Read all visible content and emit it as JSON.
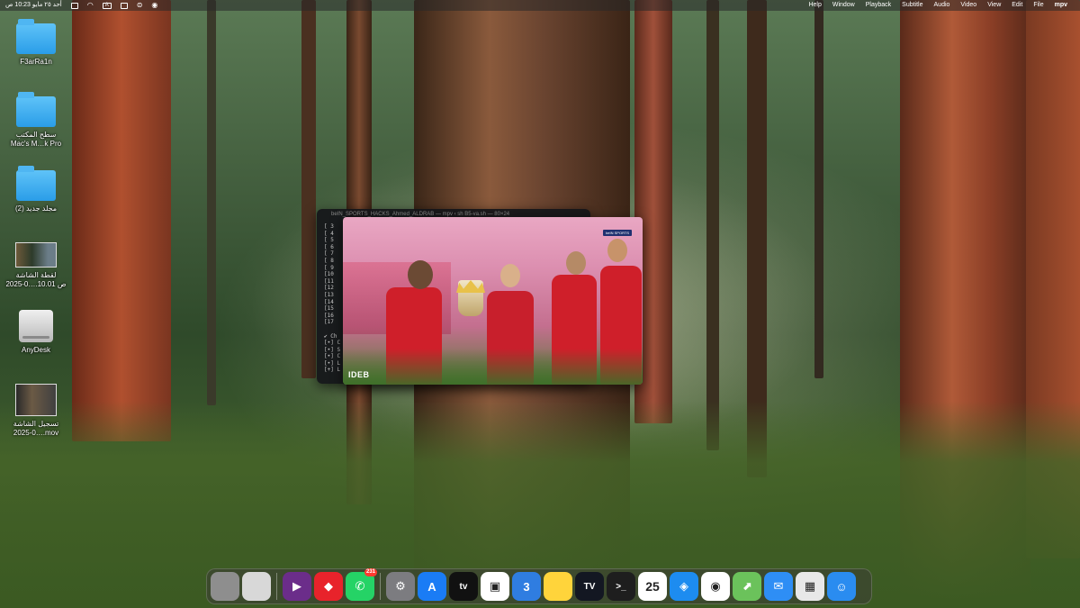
{
  "menubar": {
    "app_name": "mpv",
    "menus": [
      "File",
      "Edit",
      "View",
      "Video",
      "Audio",
      "Subtitle",
      "Playback",
      "Window",
      "Help"
    ],
    "clock": "أحد ٢٥ مايو 10:23 ص",
    "status_icons": [
      "screen-record-icon",
      "wifi-icon",
      "input-source-icon",
      "stage-manager-icon",
      "control-center-icon",
      "media-icon"
    ],
    "input_source": "A"
  },
  "desktop": {
    "items": [
      {
        "label": "F3arRa1n",
        "icon": "folder-icon"
      },
      {
        "label": "سطح المكتب\nMac's M…k Pro",
        "icon": "folder-icon"
      },
      {
        "label": "مجلد جديد (2)",
        "icon": "folder-icon"
      },
      {
        "label": "لقطة الشاشة\n2025-0….10.01 ص",
        "icon": "screenshot-thumbnail"
      },
      {
        "label": "AnyDesk",
        "icon": "drive-icon"
      },
      {
        "label": "تسجيل الشاشة\n2025-0….mov",
        "icon": "video-thumbnail"
      }
    ]
  },
  "terminal": {
    "title": "beIN_SPORTS_HACKS_Ahmed_ALDRAB — mpv ‹ sh B5-va.sh — 80×24",
    "lines": [
      "[ 3",
      "[ 4",
      "[ 5",
      "[ 6",
      "[ 7",
      "[ 8",
      "[ 9",
      "[10",
      "[11",
      "[12",
      "[13",
      "[14",
      "[15",
      "[16",
      "[17",
      "",
      "✔ Ch",
      "[•] C",
      "[•] S",
      "[•] C",
      "[•] L",
      "[+] L"
    ]
  },
  "video": {
    "overlay_logo": "IDEB",
    "channel_badge": "beIN SPORTS"
  },
  "dock": {
    "items": [
      {
        "name": "trash",
        "icon": "trash-icon",
        "label": "",
        "color": "#8e8e8e"
      },
      {
        "name": "file",
        "icon": "document-icon",
        "label": "",
        "color": "#d8d8d8"
      },
      {
        "name": "infuse",
        "icon": "play-circle-icon",
        "label": "▶",
        "color": "#6b2d8a"
      },
      {
        "name": "anydesk",
        "icon": "anydesk-icon",
        "label": "◆",
        "color": "#e8232b"
      },
      {
        "name": "whatsapp",
        "icon": "whatsapp-icon",
        "label": "✆",
        "color": "#25d366",
        "badge": "231"
      },
      {
        "name": "system-settings",
        "icon": "gear-icon",
        "label": "⚙",
        "color": "#7c7c80"
      },
      {
        "name": "app-store",
        "icon": "app-store-icon",
        "label": "A",
        "color": "#1a7cf5"
      },
      {
        "name": "apple-tv",
        "icon": "tv-icon",
        "label": "tv",
        "color": "#111111"
      },
      {
        "name": "screen-share",
        "icon": "remote-desktop-icon",
        "label": "▣",
        "color": "#ffffff"
      },
      {
        "name": "3uTools",
        "icon": "three-icon",
        "label": "3",
        "color": "#2f7de1"
      },
      {
        "name": "notes",
        "icon": "notes-icon",
        "label": "",
        "color": "#ffd43b"
      },
      {
        "name": "tradingview",
        "icon": "tradingview-icon",
        "label": "TV",
        "color": "#131722"
      },
      {
        "name": "terminal",
        "icon": "terminal-icon",
        "label": ">_",
        "color": "#1e1e1e"
      },
      {
        "name": "calendar",
        "icon": "calendar-icon",
        "label": "25",
        "color": "#ffffff"
      },
      {
        "name": "safari",
        "icon": "compass-icon",
        "label": "◈",
        "color": "#1d8cf0"
      },
      {
        "name": "chrome",
        "icon": "chrome-icon",
        "label": "◉",
        "color": "#ffffff"
      },
      {
        "name": "maps",
        "icon": "maps-icon",
        "label": "⬈",
        "color": "#6bc25b"
      },
      {
        "name": "mail",
        "icon": "mail-icon",
        "label": "✉",
        "color": "#2e8ef5"
      },
      {
        "name": "launchpad",
        "icon": "grid-icon",
        "label": "▦",
        "color": "#e8e8e8"
      },
      {
        "name": "finder",
        "icon": "finder-icon",
        "label": "☺",
        "color": "#2a8cf0"
      }
    ]
  }
}
